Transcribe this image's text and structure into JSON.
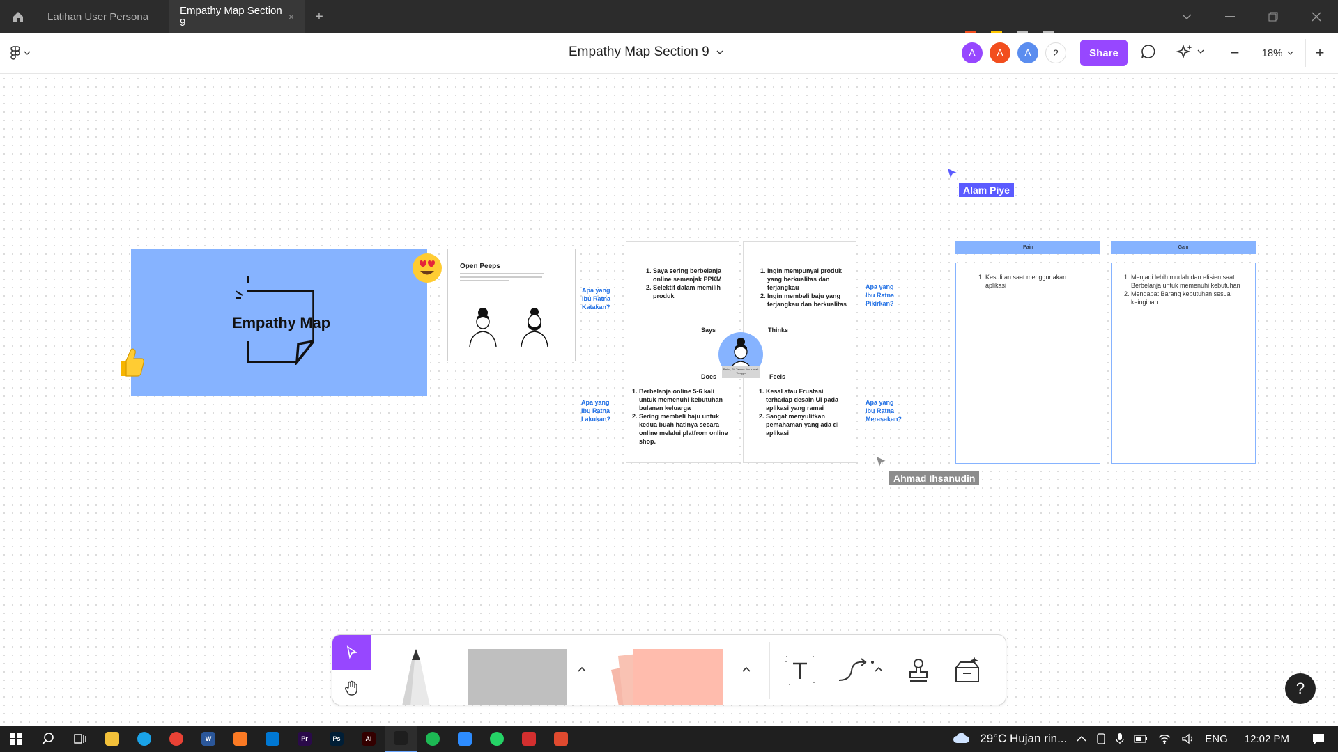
{
  "titlebar": {
    "tabs": [
      {
        "label": "Latihan User Persona",
        "active": false
      },
      {
        "label": "Empathy Map Section 9",
        "active": true
      }
    ],
    "close_glyph": "×",
    "new_tab_glyph": "+"
  },
  "toolbar": {
    "doc_title": "Empathy Map Section 9",
    "avatars": [
      {
        "initial": "A",
        "color": "#9747ff"
      },
      {
        "initial": "A",
        "color": "#f24e1e"
      },
      {
        "initial": "A",
        "color": "#5b8def"
      }
    ],
    "avatar_count": "2",
    "share_label": "Share",
    "zoom": "18%",
    "zoom_minus": "−",
    "zoom_plus": "+"
  },
  "board": {
    "cover_title": "Empathy Map",
    "peeps_title": "Open Peeps",
    "questions": {
      "says": "Apa yang Ibu Ratna Katakan?",
      "thinks": "Apa yang Ibu Ratna Pikirkan?",
      "does": "Apa yang ibu Ratna Lakukan?",
      "feels": "Apa yang Ibu Ratna Merasakan?"
    },
    "quadrants": {
      "says": {
        "label": "Says",
        "items": [
          "Saya sering berbelanja online semenjak PPKM",
          "Selektif dalam memilih produk"
        ]
      },
      "thinks": {
        "label": "Thinks",
        "items": [
          "Ingin mempunyai produk yang berkualitas dan terjangkau",
          "Ingin membeli baju yang terjangkau dan berkualitas"
        ]
      },
      "does": {
        "label": "Does",
        "items": [
          "Berbelanja online 5-6 kali untuk memenuhi kebutuhan bulanan keluarga",
          "Sering membeli baju untuk kedua buah hatinya secara online melalui platfrom online shop."
        ]
      },
      "feels": {
        "label": "Feels",
        "items": [
          "Kesal atau Frustasi terhadap desain UI pada aplikasi yang ramai",
          "Sangat menyulitkan pemahaman yang ada di aplikasi"
        ]
      }
    },
    "persona_tag": "Ratna, 34 Tahun · Ibu rumah Tangga",
    "pain": {
      "label": "Pain",
      "items": [
        "Kesulitan saat menggunakan aplikasi"
      ]
    },
    "gain": {
      "label": "Gain",
      "items": [
        "Menjadi lebih mudah dan efisien saat Berbelanja untuk memenuhi kebutuhan",
        "Mendapat Barang kebutuhan sesuai keinginan"
      ]
    }
  },
  "cursors": [
    {
      "name": "Alam Piye",
      "color": "#5b5bff"
    },
    {
      "name": "Ahmad Ihsanudin",
      "color": "#8c8c8c"
    }
  ],
  "help_label": "?",
  "taskbar": {
    "weather": "29°C  Hujan rin...",
    "lang": "ENG",
    "time": "12:02 PM",
    "apps": [
      {
        "name": "windows-start-icon",
        "color": "#ffffff",
        "text": ""
      },
      {
        "name": "search-icon",
        "color": "#1f1f1f",
        "text": ""
      },
      {
        "name": "task-view-icon",
        "color": "#1f1f1f",
        "text": ""
      },
      {
        "name": "file-explorer-icon",
        "color": "#f3c13a",
        "text": ""
      },
      {
        "name": "edge-icon",
        "color": "#1aa3e8",
        "text": ""
      },
      {
        "name": "chrome-icon",
        "color": "#e94235",
        "text": ""
      },
      {
        "name": "word-icon",
        "color": "#2b579a",
        "text": "W"
      },
      {
        "name": "xampp-icon",
        "color": "#fb7a24",
        "text": ""
      },
      {
        "name": "vscode-icon",
        "color": "#0078d4",
        "text": ""
      },
      {
        "name": "premiere-icon",
        "color": "#2a0a4a",
        "text": "Pr"
      },
      {
        "name": "photoshop-icon",
        "color": "#001e36",
        "text": "Ps"
      },
      {
        "name": "illustrator-icon",
        "color": "#330000",
        "text": "Ai"
      },
      {
        "name": "figma-icon",
        "color": "#1e1e1e",
        "text": ""
      },
      {
        "name": "spotify-icon",
        "color": "#1db954",
        "text": ""
      },
      {
        "name": "zoom-icon",
        "color": "#2d8cff",
        "text": ""
      },
      {
        "name": "whatsapp-icon",
        "color": "#25d366",
        "text": ""
      },
      {
        "name": "acrobat-icon",
        "color": "#d32f2f",
        "text": ""
      },
      {
        "name": "figma-agent-icon",
        "color": "#e04a2f",
        "text": ""
      }
    ]
  }
}
